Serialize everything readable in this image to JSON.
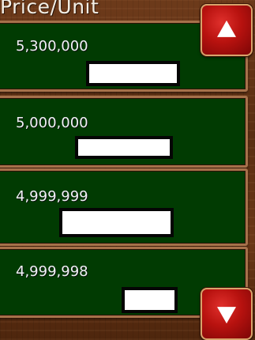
{
  "header": {
    "title": "Price/Unit"
  },
  "rows": [
    {
      "price": "5,300,000"
    },
    {
      "price": "5,000,000"
    },
    {
      "price": "4,999,999"
    },
    {
      "price": "4,999,998"
    }
  ],
  "scroll": {
    "up_icon": "arrow-up-icon",
    "down_icon": "arrow-down-icon"
  },
  "colors": {
    "row_bg": "#013b02",
    "row_border": "#a6714a",
    "button_red": "#b8120f",
    "wood": "#5a2e12"
  }
}
